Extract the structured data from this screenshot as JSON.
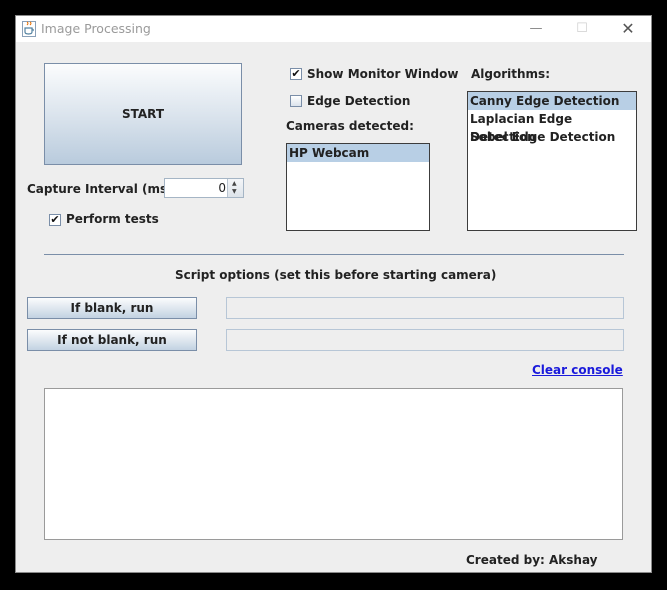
{
  "window": {
    "title": "Image Processing"
  },
  "start_label": "START",
  "capture_interval": {
    "label": "Capture Interval (ms):",
    "value": "0"
  },
  "perform_tests": {
    "label": "Perform tests",
    "checked": true
  },
  "show_monitor": {
    "label": "Show Monitor Window",
    "checked": true
  },
  "edge_detection": {
    "label": "Edge Detection",
    "checked": false
  },
  "cameras": {
    "label": "Cameras detected:",
    "items": [
      "HP Webcam"
    ],
    "selected": "HP Webcam"
  },
  "algorithms": {
    "label": "Algorithms:",
    "items": [
      "Canny Edge Detection",
      "Laplacian Edge Detection",
      "Sobel Edge Detection"
    ],
    "selected": "Canny Edge Detection"
  },
  "script_options": {
    "heading": "Script options (set this before starting camera)",
    "if_blank_label": "If blank, run",
    "if_not_blank_label": "If not blank, run",
    "if_blank_value": "",
    "if_not_blank_value": ""
  },
  "clear_console_label": "Clear console",
  "footer": "Created by: Akshay",
  "colors": {
    "selection": "#b8cfe5",
    "link": "#1a1adb",
    "window_bg": "#eeeeee"
  }
}
